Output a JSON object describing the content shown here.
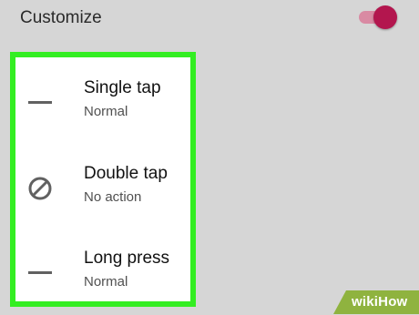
{
  "header": {
    "title": "Customize",
    "toggle_on": true,
    "toggle_color": "#b3164e"
  },
  "panel": {
    "highlight_color": "#33ee22",
    "items": [
      {
        "icon": "dash-icon",
        "label": "Single tap",
        "value": "Normal"
      },
      {
        "icon": "no-action-icon",
        "label": "Double tap",
        "value": "No action"
      },
      {
        "icon": "dash-icon",
        "label": "Long press",
        "value": "Normal"
      }
    ]
  },
  "watermark": {
    "text_wiki": "wiki",
    "text_how": "How"
  }
}
